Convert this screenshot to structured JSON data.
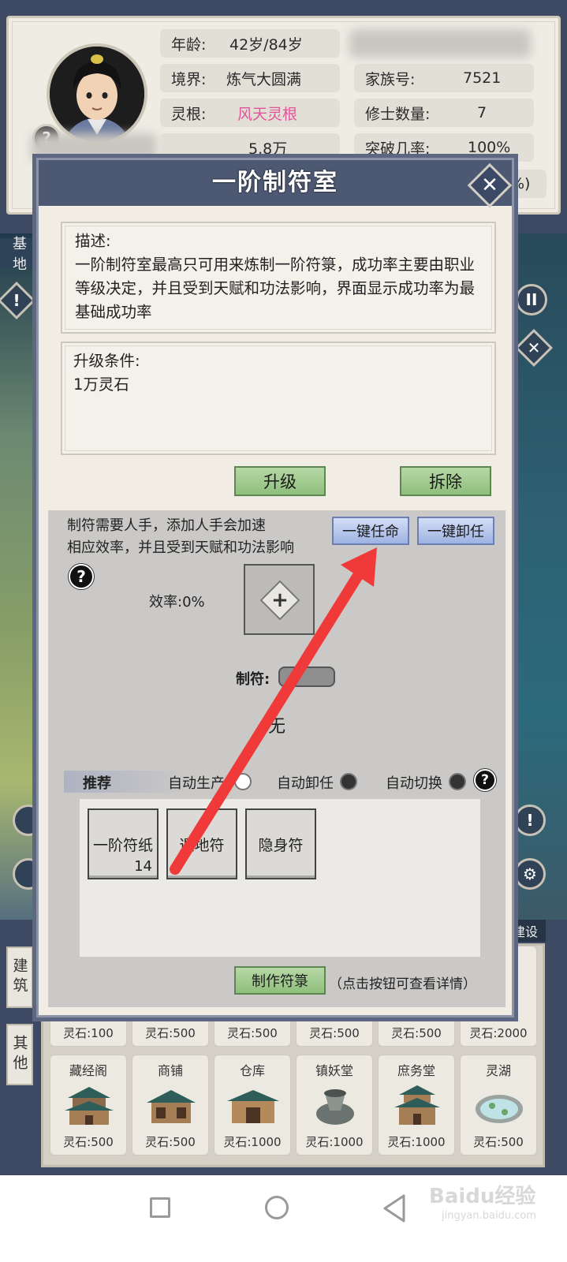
{
  "profile": {
    "age_label": "年龄:",
    "age_value": "42岁/84岁",
    "realm_label": "境界:",
    "realm_value": "炼气大圆满",
    "root_label": "灵根:",
    "root_value": "风天灵根",
    "clan_label": "家族号:",
    "clan_value": "7521",
    "cultivators_label": "修士数量:",
    "cultivators_value": "7",
    "stones_value": "5.8万",
    "breakthrough_label": "突破几率:",
    "breakthrough_value": "100%",
    "extra_suffix": "%)"
  },
  "side": {
    "base_tab": "基地",
    "pause": "II",
    "build_tab": "建设",
    "tab_build": "建筑",
    "tab_other": "其他"
  },
  "modal": {
    "title": "一阶制符室",
    "close": "✕",
    "desc_heading": "描述:",
    "desc_text": "一阶制符室最高只可用来炼制一阶符箓，成功率主要由职业等级决定，并且受到天赋和功法影响，界面显示成功率为最基础成功率",
    "upgrade_heading": "升级条件:",
    "upgrade_text": "1万灵石",
    "upgrade_button": "升级",
    "demolish_button": "拆除",
    "work_note_line1": "制符需要人手，添加人手会加速",
    "work_note_line2": "相应效率，并且受到天赋和功法影响",
    "assign_all": "一键任命",
    "dismiss_all": "一键卸任",
    "efficiency": "效率:0%",
    "craft_label": "制符:",
    "current_item": "无",
    "recommend": "推荐",
    "auto_produce": "自动生产",
    "auto_dismiss": "自动卸任",
    "auto_switch": "自动切换",
    "items": [
      {
        "name": "一阶符纸",
        "count": "14"
      },
      {
        "name": "遁地符",
        "count": ""
      },
      {
        "name": "隐身符",
        "count": ""
      }
    ],
    "make_button": "制作符箓",
    "make_hint": "（点击按钮可查看详情）",
    "help": "?"
  },
  "buildings": {
    "row1": [
      {
        "cost": "灵石:100"
      },
      {
        "cost": "灵石:500"
      },
      {
        "cost": "灵石:500"
      },
      {
        "cost": "灵石:500"
      },
      {
        "cost": "灵石:500"
      },
      {
        "cost": "灵石:2000"
      }
    ],
    "row2": [
      {
        "name": "藏经阁",
        "cost": "灵石:500"
      },
      {
        "name": "商铺",
        "cost": "灵石:500"
      },
      {
        "name": "仓库",
        "cost": "灵石:1000"
      },
      {
        "name": "镇妖堂",
        "cost": "灵石:1000"
      },
      {
        "name": "庶务堂",
        "cost": "灵石:1000"
      },
      {
        "name": "灵湖",
        "cost": "灵石:500"
      }
    ]
  },
  "watermark": {
    "line1": "Baidu经验",
    "line2": "jingyan.baidu.com"
  },
  "colors": {
    "title_bar": "#4d5873",
    "green_button": "#8fbf7c",
    "blue_button": "#9eb3e2",
    "annotation_arrow": "#f03a3a",
    "root_value": "#e0559a"
  }
}
